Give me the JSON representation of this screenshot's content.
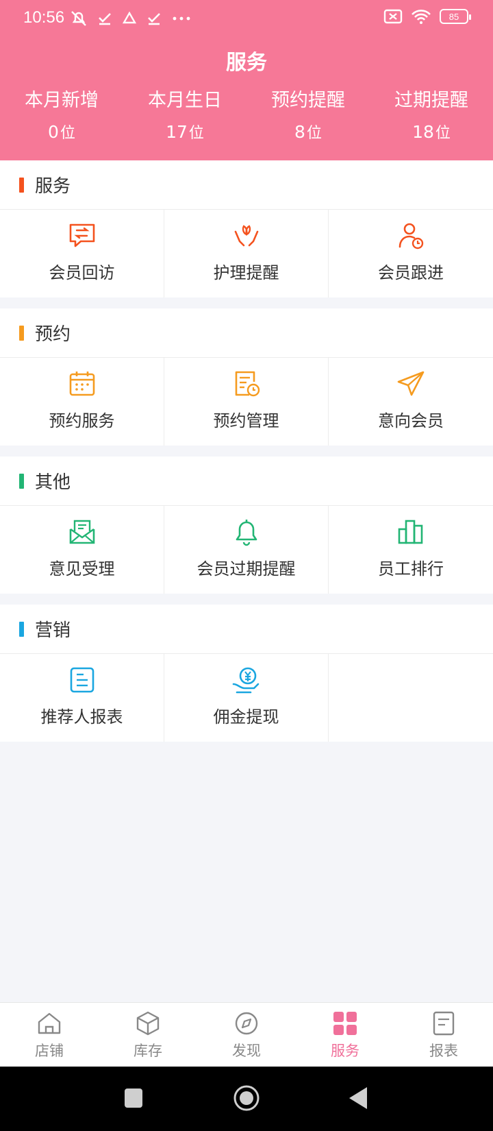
{
  "status": {
    "time": "10:56",
    "battery": "85"
  },
  "header": {
    "title": "服务",
    "stats": [
      {
        "label": "本月新增",
        "value": "0",
        "unit": "位"
      },
      {
        "label": "本月生日",
        "value": "17",
        "unit": "位"
      },
      {
        "label": "预约提醒",
        "value": "8",
        "unit": "位"
      },
      {
        "label": "过期提醒",
        "value": "18",
        "unit": "位"
      }
    ]
  },
  "colors": {
    "header_bg": "#f67897",
    "service_accent": "#f4521e",
    "booking_accent": "#f59b1f",
    "other_accent": "#22b574",
    "marketing_accent": "#1aa6e0",
    "active_nav": "#f0709a"
  },
  "sections": [
    {
      "title": "服务",
      "items": [
        {
          "label": "会员回访",
          "icon": "chat-exchange-icon"
        },
        {
          "label": "护理提醒",
          "icon": "care-hands-icon"
        },
        {
          "label": "会员跟进",
          "icon": "user-clock-icon"
        }
      ]
    },
    {
      "title": "预约",
      "items": [
        {
          "label": "预约服务",
          "icon": "calendar-icon"
        },
        {
          "label": "预约管理",
          "icon": "document-clock-icon"
        },
        {
          "label": "意向会员",
          "icon": "paper-plane-icon"
        }
      ]
    },
    {
      "title": "其他",
      "items": [
        {
          "label": "意见受理",
          "icon": "mail-icon"
        },
        {
          "label": "会员过期提醒",
          "icon": "bell-icon"
        },
        {
          "label": "员工排行",
          "icon": "bar-chart-icon"
        }
      ]
    },
    {
      "title": "营销",
      "items": [
        {
          "label": "推荐人报表",
          "icon": "report-icon"
        },
        {
          "label": "佣金提现",
          "icon": "yuan-hand-icon"
        }
      ]
    }
  ],
  "nav": [
    {
      "label": "店铺",
      "icon": "home-icon"
    },
    {
      "label": "库存",
      "icon": "box-icon"
    },
    {
      "label": "发现",
      "icon": "compass-icon"
    },
    {
      "label": "服务",
      "icon": "grid-icon",
      "active": true
    },
    {
      "label": "报表",
      "icon": "report-icon"
    }
  ]
}
